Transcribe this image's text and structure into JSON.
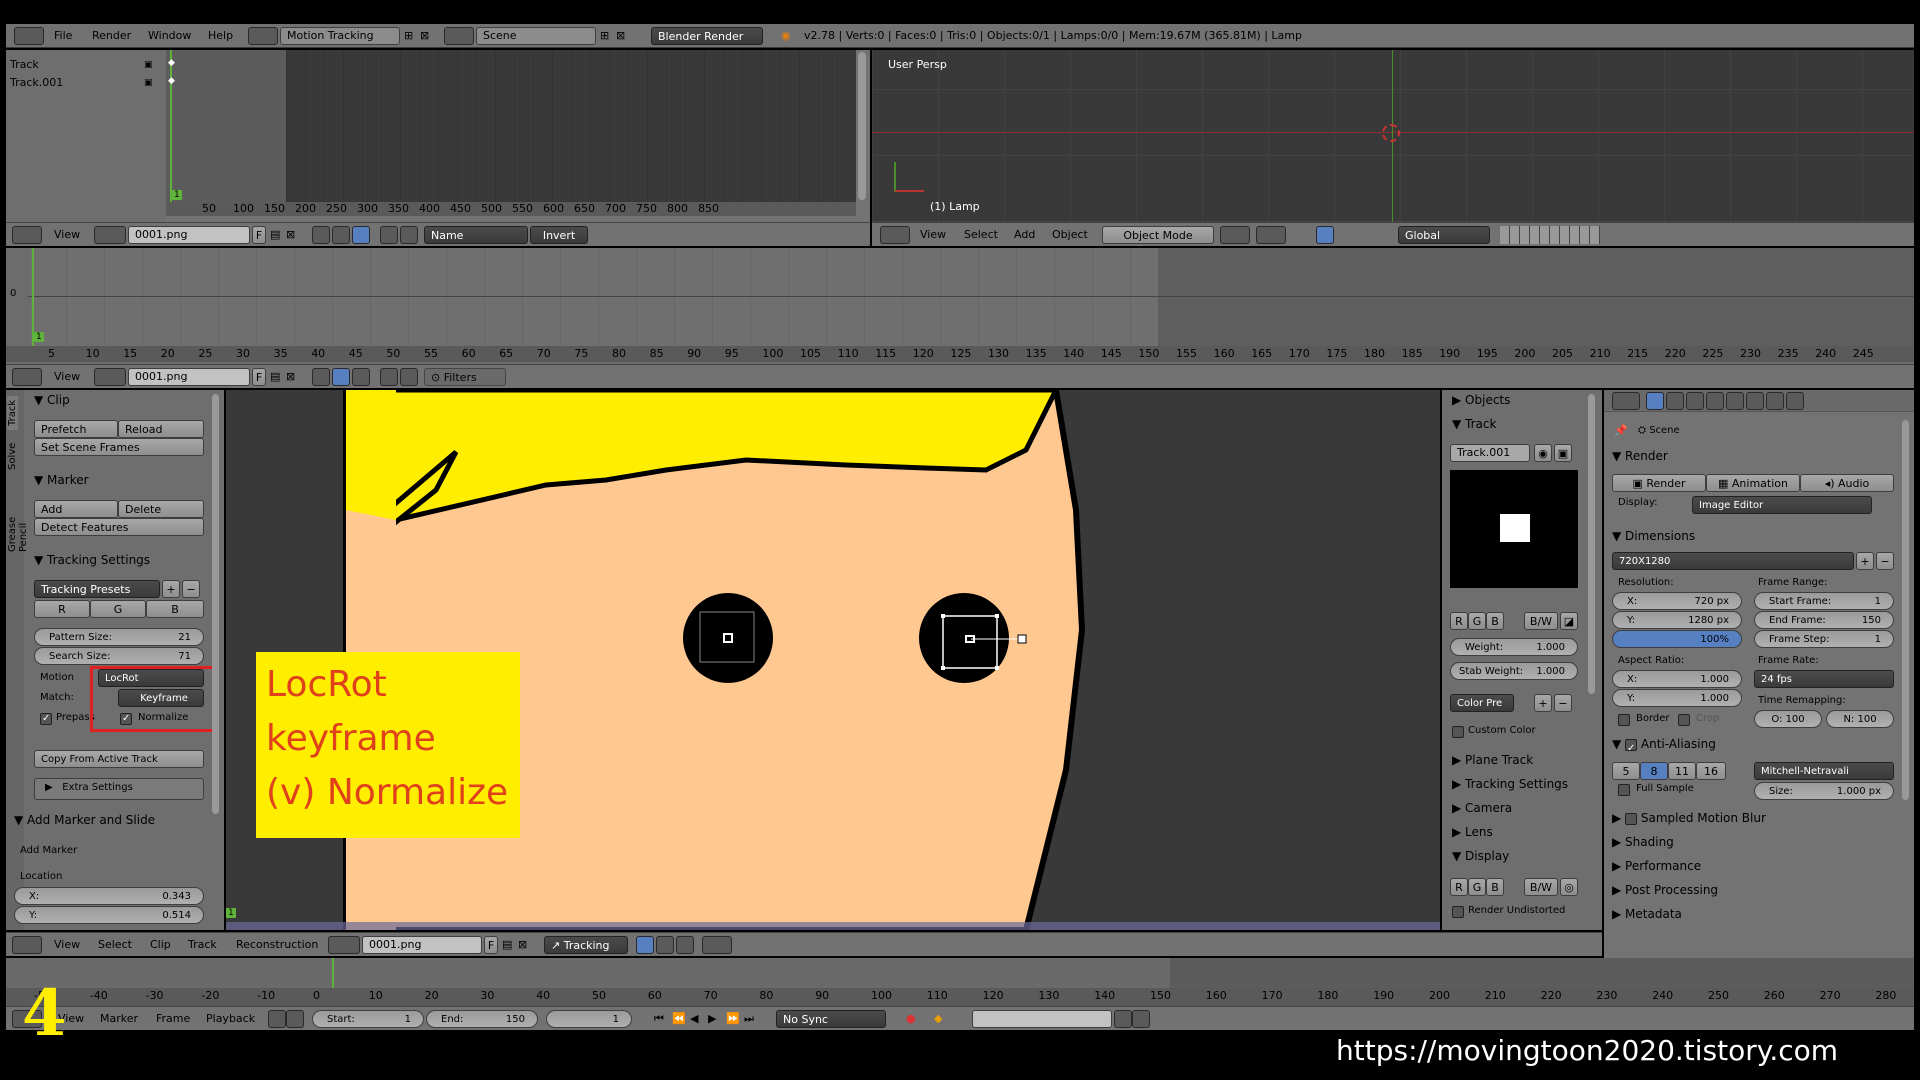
{
  "topbar": {
    "menus": [
      "File",
      "Render",
      "Window",
      "Help"
    ],
    "screen_layout": "Motion Tracking",
    "scene": "Scene",
    "engine": "Blender Render",
    "info": "v2.78 | Verts:0 | Faces:0 | Tris:0 | Objects:0/1 | Lamps:0/0 | Mem:19.67M (365.81M) | Lamp"
  },
  "dopesheet": {
    "tracks": [
      "Track",
      "Track.001"
    ],
    "ticks": [
      "50",
      "100",
      "150",
      "200",
      "250",
      "300",
      "350",
      "400",
      "450",
      "500",
      "550",
      "600",
      "650",
      "700",
      "750",
      "800",
      "850"
    ],
    "frame_marker": "1",
    "header": {
      "view": "View",
      "clip": "0001.png",
      "f": "F",
      "sort": "Name",
      "invert": "Invert"
    }
  },
  "viewport": {
    "label": "User Persp",
    "object_label": "(1) Lamp",
    "header": {
      "view": "View",
      "select": "Select",
      "add": "Add",
      "object": "Object",
      "mode": "Object Mode",
      "orientation": "Global"
    }
  },
  "graph": {
    "ticks": [
      "5",
      "10",
      "15",
      "20",
      "25",
      "30",
      "35",
      "40",
      "45",
      "50",
      "55",
      "60",
      "65",
      "70",
      "75",
      "80",
      "85",
      "90",
      "95",
      "100",
      "105",
      "110",
      "115",
      "120",
      "125",
      "130",
      "135",
      "140",
      "145",
      "150",
      "155",
      "160",
      "165",
      "170",
      "175",
      "180",
      "185",
      "190",
      "195",
      "200",
      "205",
      "210",
      "215",
      "220",
      "225",
      "230",
      "235",
      "240",
      "245"
    ],
    "frame_marker": "1",
    "y_label": "0",
    "header": {
      "view": "View",
      "clip": "0001.png",
      "f": "F",
      "filters": "Filters"
    }
  },
  "toolshelf": {
    "tabs": [
      "Track",
      "Solve",
      "Grease Pencil"
    ],
    "clip": {
      "title": "Clip",
      "prefetch": "Prefetch",
      "reload": "Reload",
      "set_scene_frames": "Set Scene Frames"
    },
    "marker": {
      "title": "Marker",
      "add": "Add",
      "delete": "Delete",
      "detect": "Detect Features"
    },
    "tracking": {
      "title": "Tracking Settings",
      "presets": "Tracking Presets",
      "r": "R",
      "g": "G",
      "b": "B",
      "pattern_label": "Pattern Size:",
      "pattern_value": "21",
      "search_label": "Search Size:",
      "search_value": "71",
      "motion_label": "Motion",
      "motion_value": "LocRot",
      "match_label": "Match:",
      "match_value": "Keyframe",
      "prepass": "Prepass",
      "normalize": "Normalize",
      "copy": "Copy From Active Track",
      "extra": "Extra Settings"
    },
    "add_marker": {
      "title": "Add Marker and Slide",
      "label": "Add Marker",
      "location": "Location",
      "x_label": "X:",
      "x_value": "0.343",
      "y_label": "Y:",
      "y_value": "0.514"
    }
  },
  "annotation": {
    "line1": "LocRot",
    "line2": "keyframe",
    "line3": "(v) Normalize"
  },
  "clip_editor": {
    "frame_marker": "1",
    "header": {
      "view": "View",
      "select": "Select",
      "clip": "Clip",
      "track": "Track",
      "reconstruction": "Reconstruction",
      "clip_name": "0001.png",
      "f": "F",
      "mode": "Tracking"
    }
  },
  "properties_n": {
    "objects": "Objects",
    "track": "Track",
    "track_name": "Track.001",
    "r": "R",
    "g": "G",
    "b": "B",
    "bw": "B/W",
    "weight_label": "Weight:",
    "weight_value": "1.000",
    "stab_label": "Stab Weight:",
    "stab_value": "1.000",
    "color_preset": "Color Pre",
    "custom_color": "Custom Color",
    "plane_track": "Plane Track",
    "tracking_settings": "Tracking Settings",
    "camera": "Camera",
    "lens": "Lens",
    "display": "Display",
    "render_undistorted": "Render Undistorted"
  },
  "render_props": {
    "scene": "Scene",
    "render": "Render",
    "btn_render": "Render",
    "btn_animation": "Animation",
    "btn_audio": "Audio",
    "display_label": "Display:",
    "display_value": "Image Editor",
    "dimensions": "Dimensions",
    "preset": "720X1280",
    "resolution": "Resolution:",
    "res_x_label": "X:",
    "res_x": "720 px",
    "res_y_label": "Y:",
    "res_y": "1280 px",
    "res_pct": "100%",
    "frame_range": "Frame Range:",
    "start_label": "Start Frame:",
    "start": "1",
    "end_label": "End Frame:",
    "end": "150",
    "step_label": "Frame Step:",
    "step": "1",
    "aspect": "Aspect Ratio:",
    "asp_x_label": "X:",
    "asp_x": "1.000",
    "asp_y_label": "Y:",
    "asp_y": "1.000",
    "frame_rate": "Frame Rate:",
    "fps": "24 fps",
    "border": "Border",
    "crop": "Crop",
    "time_remap": "Time Remapping:",
    "remap_old": "O: 100",
    "remap_new": "N: 100",
    "aa": "Anti-Aliasing",
    "aa_samples": [
      "5",
      "8",
      "11",
      "16"
    ],
    "aa_filter": "Mitchell-Netravali",
    "full_sample": "Full Sample",
    "size_label": "Size:",
    "size_value": "1.000 px",
    "sampled_motion_blur": "Sampled Motion Blur",
    "shading": "Shading",
    "performance": "Performance",
    "post_processing": "Post Processing",
    "metadata": "Metadata"
  },
  "timeline": {
    "ticks": [
      "-50",
      "-40",
      "-30",
      "-20",
      "-10",
      "0",
      "10",
      "20",
      "30",
      "40",
      "50",
      "60",
      "70",
      "80",
      "90",
      "100",
      "110",
      "120",
      "130",
      "140",
      "150",
      "160",
      "170",
      "180",
      "190",
      "200",
      "210",
      "220",
      "230",
      "240",
      "250",
      "260",
      "270",
      "280"
    ],
    "header": {
      "view": "View",
      "marker": "Marker",
      "frame": "Frame",
      "playback": "Playback",
      "start_label": "Start:",
      "start": "1",
      "end_label": "End:",
      "end": "150",
      "current": "1",
      "sync": "No Sync"
    }
  },
  "overlay": {
    "step_number": "4",
    "url": "https://movingtoon2020.tistory.com"
  },
  "colors": {
    "accent_blue": "#5680c2",
    "annotation_bg": "#ffee00",
    "annotation_text": "#e0401a",
    "highlight_box": "#e02020",
    "hair": "#ffee00",
    "skin": "#ffc890"
  }
}
